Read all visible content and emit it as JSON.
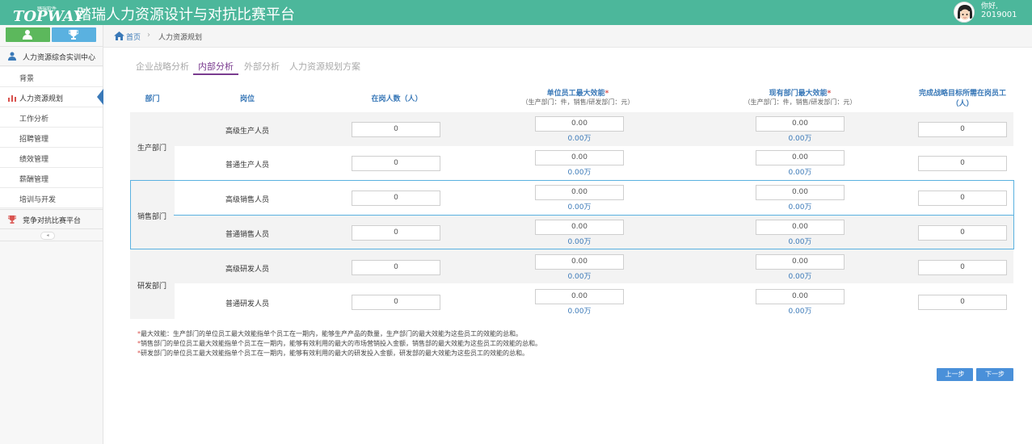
{
  "header": {
    "logo_text": "TOPWAY",
    "logo_sub": "踏瑞软件",
    "title": "踏瑞人力资源设计与对抗比赛平台",
    "greeting": "你好,",
    "user_id": "2019001"
  },
  "sidebar": {
    "sections": [
      {
        "label": "人力资源综合实训中心"
      },
      {
        "label": "竞争对抗比赛平台"
      }
    ],
    "items": [
      {
        "label": "背景"
      },
      {
        "label": "人力资源规划"
      },
      {
        "label": "工作分析"
      },
      {
        "label": "招聘管理"
      },
      {
        "label": "绩效管理"
      },
      {
        "label": "薪酬管理"
      },
      {
        "label": "培训与开发"
      }
    ],
    "collapse_symbol": "◂"
  },
  "breadcrumb": {
    "home": "首页",
    "sep": "›",
    "current": "人力资源规划"
  },
  "tabs": [
    {
      "label": "企业战略分析",
      "active": false
    },
    {
      "label": "内部分析",
      "active": true
    },
    {
      "label": "外部分析",
      "active": false
    },
    {
      "label": "人力资源规划方案",
      "active": false
    }
  ],
  "table": {
    "headers": {
      "dept": "部门",
      "position": "岗位",
      "count": "在岗人数（人）",
      "unit_eff": "单位员工最大效能",
      "unit_eff_sub": "（生产部门：件，销售/研发部门：元）",
      "dept_eff": "现有部门最大效能",
      "dept_eff_sub": "（生产部门：件，销售/研发部门：元）",
      "target_line1": "完成战略目标所需在岗员工",
      "target_line2": "（人）",
      "required_mark": "*"
    },
    "departments": [
      {
        "name": "生产部门"
      },
      {
        "name": "销售部门"
      },
      {
        "name": "研发部门"
      }
    ],
    "rows": [
      {
        "position": "高级生产人员",
        "count": "0",
        "unit_eff": "0.00",
        "unit_wan": "0.00万",
        "dept_eff": "0.00",
        "dept_wan": "0.00万",
        "target": "0"
      },
      {
        "position": "普通生产人员",
        "count": "0",
        "unit_eff": "0.00",
        "unit_wan": "0.00万",
        "dept_eff": "0.00",
        "dept_wan": "0.00万",
        "target": "0"
      },
      {
        "position": "高级销售人员",
        "count": "0",
        "unit_eff": "0.00",
        "unit_wan": "0.00万",
        "dept_eff": "0.00",
        "dept_wan": "0.00万",
        "target": "0"
      },
      {
        "position": "普通销售人员",
        "count": "0",
        "unit_eff": "0.00",
        "unit_wan": "0.00万",
        "dept_eff": "0.00",
        "dept_wan": "0.00万",
        "target": "0"
      },
      {
        "position": "高级研发人员",
        "count": "0",
        "unit_eff": "0.00",
        "unit_wan": "0.00万",
        "dept_eff": "0.00",
        "dept_wan": "0.00万",
        "target": "0"
      },
      {
        "position": "普通研发人员",
        "count": "0",
        "unit_eff": "0.00",
        "unit_wan": "0.00万",
        "dept_eff": "0.00",
        "dept_wan": "0.00万",
        "target": "0"
      }
    ]
  },
  "notes": [
    "最大效能：生产部门的单位员工最大效能指单个员工在一期内，能够生产产品的数量，生产部门的最大效能为这些员工的效能的总和。",
    "销售部门的单位员工最大效能指单个员工在一期内，能够有效利用的最大的市场营销投入金额，销售部的最大效能为这些员工的效能的总和。",
    "研发部门的单位员工最大效能指单个员工在一期内，能够有效利用的最大的研发投入金额，研发部的最大效能为这些员工的效能的总和。"
  ],
  "buttons": {
    "prev": "上一步",
    "next": "下一步"
  },
  "colors": {
    "header_bg": "#4cb79b",
    "accent_blue": "#3a79b8",
    "tab_active": "#7a3b8f",
    "button_blue": "#4a90d9"
  }
}
